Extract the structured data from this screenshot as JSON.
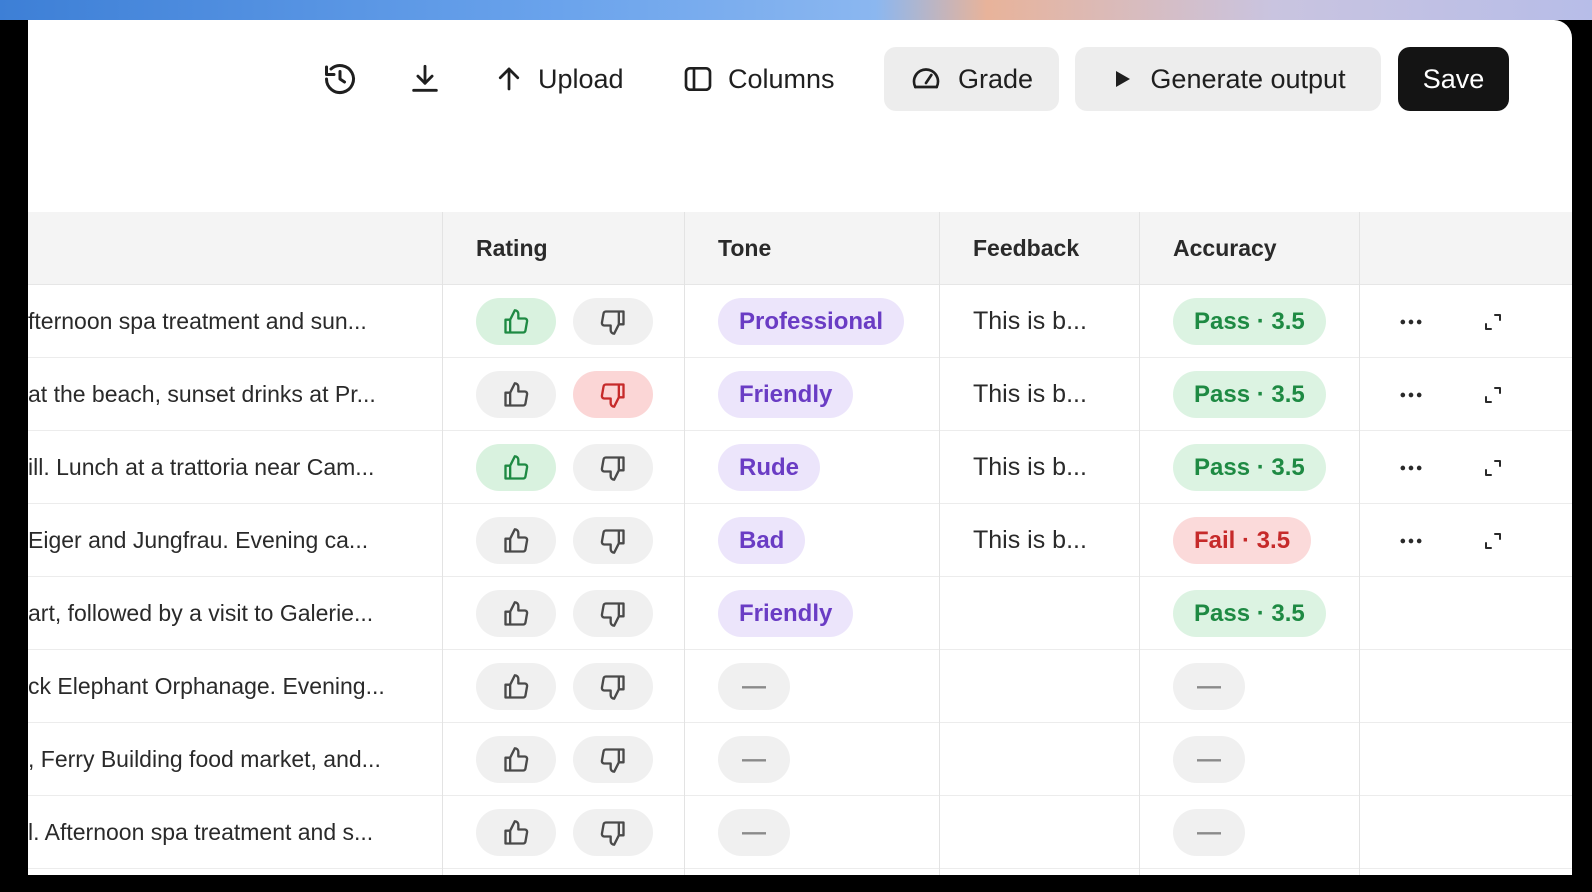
{
  "toolbar": {
    "upload_label": "Upload",
    "columns_label": "Columns",
    "grade_label": "Grade",
    "generate_label": "Generate output",
    "save_label": "Save"
  },
  "table": {
    "headers": [
      "Rating",
      "Tone",
      "Feedback",
      "Accuracy"
    ],
    "rows": [
      {
        "input": "fternoon spa treatment and sun...",
        "rating": "up",
        "tone": "Professional",
        "feedback": "This is b...",
        "accuracy": "Pass · 3.5",
        "accuracy_status": "pass",
        "actions": true
      },
      {
        "input": "at the beach, sunset drinks at Pr...",
        "rating": "down",
        "tone": "Friendly",
        "feedback": "This is b...",
        "accuracy": "Pass · 3.5",
        "accuracy_status": "pass",
        "actions": true
      },
      {
        "input": "ill. Lunch at a trattoria near Cam...",
        "rating": "up",
        "tone": "Rude",
        "feedback": "This is b...",
        "accuracy": "Pass · 3.5",
        "accuracy_status": "pass",
        "actions": true
      },
      {
        "input": " Eiger and Jungfrau. Evening ca...",
        "rating": "none",
        "tone": "Bad",
        "feedback": "This is b...",
        "accuracy": "Fail · 3.5",
        "accuracy_status": "fail",
        "actions": true
      },
      {
        "input": "art, followed by a visit to Galerie...",
        "rating": "none",
        "tone": "Friendly",
        "feedback": "",
        "accuracy": "Pass · 3.5",
        "accuracy_status": "pass",
        "actions": false
      },
      {
        "input": "ck Elephant Orphanage. Evening...",
        "rating": "none",
        "tone": "—",
        "feedback": "",
        "accuracy": "—",
        "accuracy_status": "empty",
        "actions": false
      },
      {
        "input": ", Ferry Building food market, and...",
        "rating": "none",
        "tone": "—",
        "feedback": "",
        "accuracy": "—",
        "accuracy_status": "empty",
        "actions": false
      },
      {
        "input": "l. Afternoon spa treatment and s...",
        "rating": "none",
        "tone": "—",
        "feedback": "",
        "accuracy": "—",
        "accuracy_status": "empty",
        "actions": false
      }
    ]
  },
  "colors": {
    "accent_green": "#1e8a43",
    "accent_red": "#c62a2a",
    "accent_purple": "#6a3cc4",
    "primary_button": "#141414"
  },
  "icons": {
    "history": "history-icon",
    "download": "download-icon",
    "upload": "arrow-up-icon",
    "columns": "columns-icon",
    "grade": "gauge-icon",
    "generate": "play-icon",
    "more": "ellipsis-icon",
    "expand": "expand-icon",
    "thumbs_up": "thumbs-up-icon",
    "thumbs_down": "thumbs-down-icon"
  }
}
